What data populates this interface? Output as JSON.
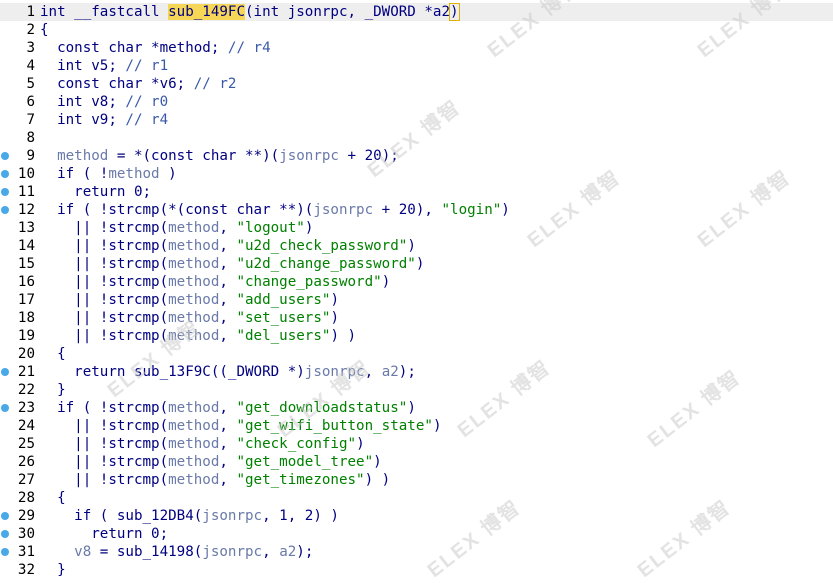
{
  "editor": {
    "header_highlight": "sub_149FC",
    "lines": [
      {
        "num": "1",
        "bp": false,
        "html": "int __fastcall <span class=\"hl\">sub_149FC</span>(int jsonrpc, _DWORD *a2<span class=\"cur\">)</span>"
      },
      {
        "num": "2",
        "bp": false,
        "html": "{"
      },
      {
        "num": "3",
        "bp": false,
        "html": "  const char *method; <span class=\"cm\">// r4</span>"
      },
      {
        "num": "4",
        "bp": false,
        "html": "  int v5; <span class=\"cm\">// r1</span>"
      },
      {
        "num": "5",
        "bp": false,
        "html": "  const char *v6; <span class=\"cm\">// r2</span>"
      },
      {
        "num": "6",
        "bp": false,
        "html": "  int v8; <span class=\"cm\">// r0</span>"
      },
      {
        "num": "7",
        "bp": false,
        "html": "  int v9; <span class=\"cm\">// r4</span>"
      },
      {
        "num": "8",
        "bp": false,
        "html": ""
      },
      {
        "num": "9",
        "bp": true,
        "html": "  <span class=\"var\">method</span> = *(const char **)(<span class=\"var\">jsonrpc</span> + 20);"
      },
      {
        "num": "10",
        "bp": true,
        "html": "  if ( !<span class=\"var\">method</span> )"
      },
      {
        "num": "11",
        "bp": true,
        "html": "    return 0;"
      },
      {
        "num": "12",
        "bp": true,
        "html": "  if ( !strcmp(*(const char **)(<span class=\"var\">jsonrpc</span> + 20), <span class=\"str\">\"login\"</span>)"
      },
      {
        "num": "13",
        "bp": false,
        "html": "    || !strcmp(<span class=\"var\">method</span>, <span class=\"str\">\"logout\"</span>)"
      },
      {
        "num": "14",
        "bp": false,
        "html": "    || !strcmp(<span class=\"var\">method</span>, <span class=\"str\">\"u2d_check_password\"</span>)"
      },
      {
        "num": "15",
        "bp": false,
        "html": "    || !strcmp(<span class=\"var\">method</span>, <span class=\"str\">\"u2d_change_password\"</span>)"
      },
      {
        "num": "16",
        "bp": false,
        "html": "    || !strcmp(<span class=\"var\">method</span>, <span class=\"str\">\"change_password\"</span>)"
      },
      {
        "num": "17",
        "bp": false,
        "html": "    || !strcmp(<span class=\"var\">method</span>, <span class=\"str\">\"add_users\"</span>)"
      },
      {
        "num": "18",
        "bp": false,
        "html": "    || !strcmp(<span class=\"var\">method</span>, <span class=\"str\">\"set_users\"</span>)"
      },
      {
        "num": "19",
        "bp": false,
        "html": "    || !strcmp(<span class=\"var\">method</span>, <span class=\"str\">\"del_users\"</span>) )"
      },
      {
        "num": "20",
        "bp": false,
        "html": "  {"
      },
      {
        "num": "21",
        "bp": true,
        "html": "    return sub_13F9C((_DWORD *)<span class=\"var\">jsonrpc</span>, <span class=\"var\">a2</span>);"
      },
      {
        "num": "22",
        "bp": false,
        "html": "  }"
      },
      {
        "num": "23",
        "bp": true,
        "html": "  if ( !strcmp(<span class=\"var\">method</span>, <span class=\"str\">\"get_downloadstatus\"</span>)"
      },
      {
        "num": "24",
        "bp": false,
        "html": "    || !strcmp(<span class=\"var\">method</span>, <span class=\"str\">\"get_wifi_button_state\"</span>)"
      },
      {
        "num": "25",
        "bp": false,
        "html": "    || !strcmp(<span class=\"var\">method</span>, <span class=\"str\">\"check_config\"</span>)"
      },
      {
        "num": "26",
        "bp": false,
        "html": "    || !strcmp(<span class=\"var\">method</span>, <span class=\"str\">\"get_model_tree\"</span>)"
      },
      {
        "num": "27",
        "bp": false,
        "html": "    || !strcmp(<span class=\"var\">method</span>, <span class=\"str\">\"get_timezones\"</span>) )"
      },
      {
        "num": "28",
        "bp": false,
        "html": "  {"
      },
      {
        "num": "29",
        "bp": true,
        "html": "    if ( sub_12DB4(<span class=\"var\">jsonrpc</span>, 1, 2) )"
      },
      {
        "num": "30",
        "bp": true,
        "html": "      return 0;"
      },
      {
        "num": "31",
        "bp": true,
        "html": "    <span class=\"var\">v8</span> = sub_14198(<span class=\"var\">jsonrpc</span>, <span class=\"var\">a2</span>);"
      },
      {
        "num": "32",
        "bp": false,
        "html": "  }"
      }
    ]
  },
  "watermark_text": "ELEX 博智",
  "colors": {
    "breakpoint": "#49a8e8",
    "string": "#008000",
    "variable": "#6a7aa9",
    "keyword": "#000080",
    "highlight": "#f5d657"
  }
}
